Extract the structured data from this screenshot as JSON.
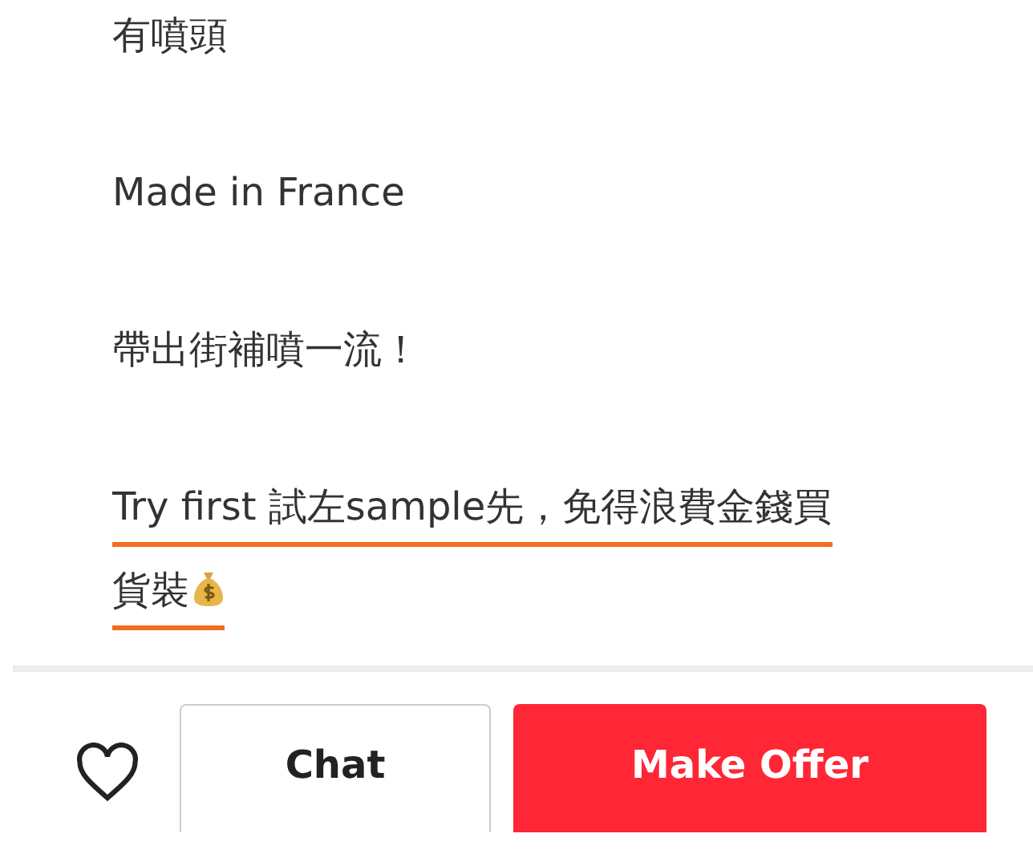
{
  "description": [
    {
      "lines": [
        "有噴頭"
      ],
      "underlined": false
    },
    {
      "lines": [
        "Made in France"
      ],
      "underlined": false
    },
    {
      "lines": [
        "帶出街補噴一流！"
      ],
      "underlined": false
    },
    {
      "lines": [
        "Try first 試左sample先，免得浪費金錢買",
        "貨裝"
      ],
      "underlined": true
    }
  ],
  "action_bar": {
    "liked": false,
    "chat_button": "Chat",
    "offer_button": "Make Offer"
  }
}
